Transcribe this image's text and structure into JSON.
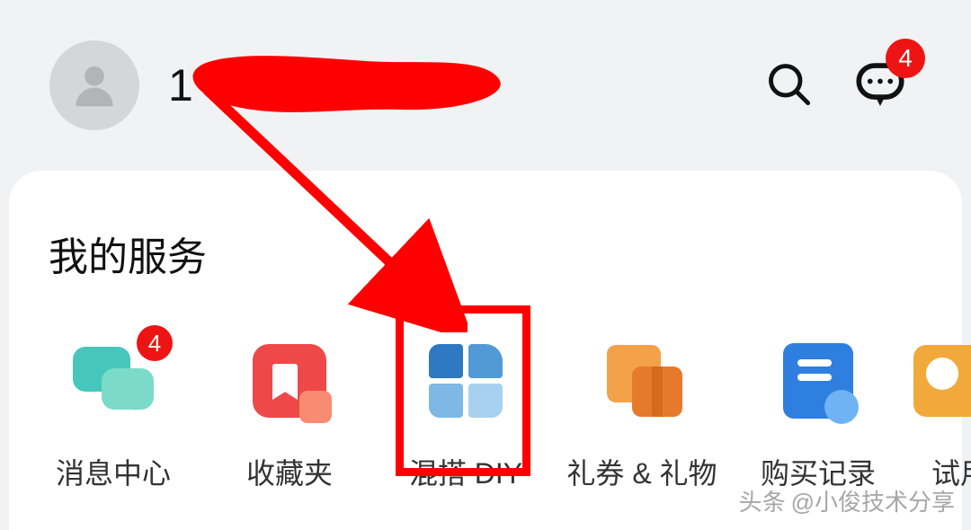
{
  "header": {
    "username_visible_prefix": "1",
    "chat_badge": "4"
  },
  "section": {
    "title": "我的服务"
  },
  "services": [
    {
      "label": "消息中心",
      "badge": "4",
      "icon": "message-icon"
    },
    {
      "label": "收藏夹",
      "badge": null,
      "icon": "favorites-icon"
    },
    {
      "label": "混搭 DIY",
      "badge": null,
      "icon": "diy-icon"
    },
    {
      "label": "礼券 & 礼物",
      "badge": null,
      "icon": "gift-icon"
    },
    {
      "label": "购买记录",
      "badge": null,
      "icon": "purchase-record-icon"
    },
    {
      "label": "试用",
      "badge": null,
      "icon": "trial-icon"
    }
  ],
  "annotation": {
    "highlighted_service_index": 2
  },
  "watermark": {
    "prefix": "头条",
    "handle": "@小俊技术分享"
  }
}
